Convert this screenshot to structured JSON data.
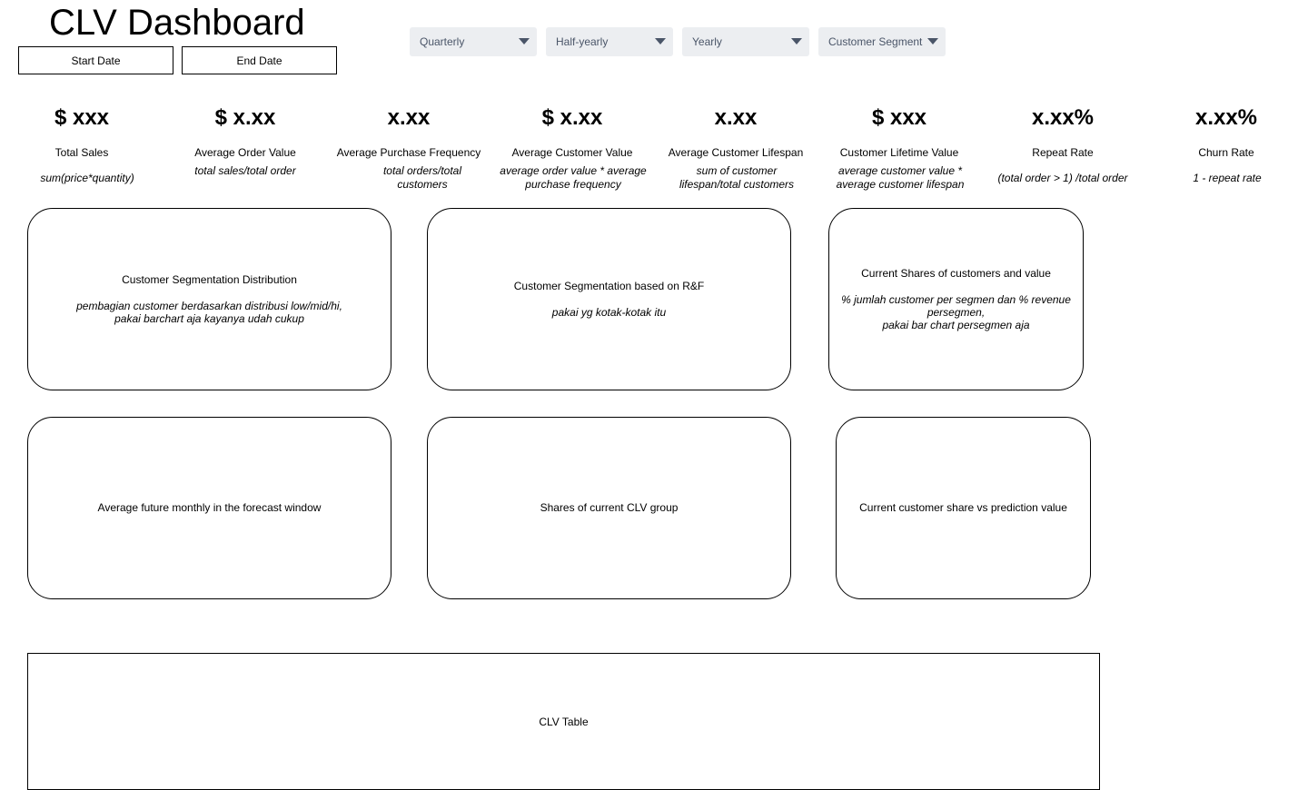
{
  "header": {
    "title": "CLV Dashboard",
    "start_date_label": "Start Date",
    "end_date_label": "End Date"
  },
  "filters": {
    "quarterly": "Quarterly",
    "halfyearly": "Half-yearly",
    "yearly": "Yearly",
    "segment": "Customer Segment"
  },
  "kpis": [
    {
      "value": "$ xxx",
      "name": "Total Sales",
      "formula": "sum(price*quantity)"
    },
    {
      "value": "$ x.xx",
      "name": "Average Order Value",
      "formula": "total sales/total order"
    },
    {
      "value": "x.xx",
      "name": "Average Purchase Frequency",
      "formula": "total orders/total customers"
    },
    {
      "value": "$ x.xx",
      "name": "Average Customer Value",
      "formula": "average order value * average purchase frequency"
    },
    {
      "value": "x.xx",
      "name": "Average Customer Lifespan",
      "formula": "sum of customer lifespan/total customers"
    },
    {
      "value": "$ xxx",
      "name": "Customer Lifetime Value",
      "formula": "average customer value * average customer lifespan"
    },
    {
      "value": "x.xx%",
      "name": "Repeat Rate",
      "formula": "(total order > 1) /total order"
    },
    {
      "value": "x.xx%",
      "name": "Churn Rate",
      "formula": "1 - repeat rate"
    }
  ],
  "cards": {
    "seg_dist": {
      "title": "Customer Segmentation Distribution",
      "note": "pembagian customer berdasarkan distribusi low/mid/hi,\npakai barchart aja kayanya udah cukup"
    },
    "seg_rf": {
      "title": "Customer Segmentation based on R&F",
      "note": "pakai yg kotak-kotak itu"
    },
    "shares_value": {
      "title": "Current Shares of customers and value",
      "note": "% jumlah customer per segmen dan % revenue persegmen,\npakai bar chart persegmen aja"
    },
    "future_monthly": {
      "title": "Average future monthly in the forecast window"
    },
    "clv_group": {
      "title": "Shares of current CLV group"
    },
    "share_vs_pred": {
      "title": "Current customer share vs prediction value"
    }
  },
  "table": {
    "label": "CLV Table"
  }
}
